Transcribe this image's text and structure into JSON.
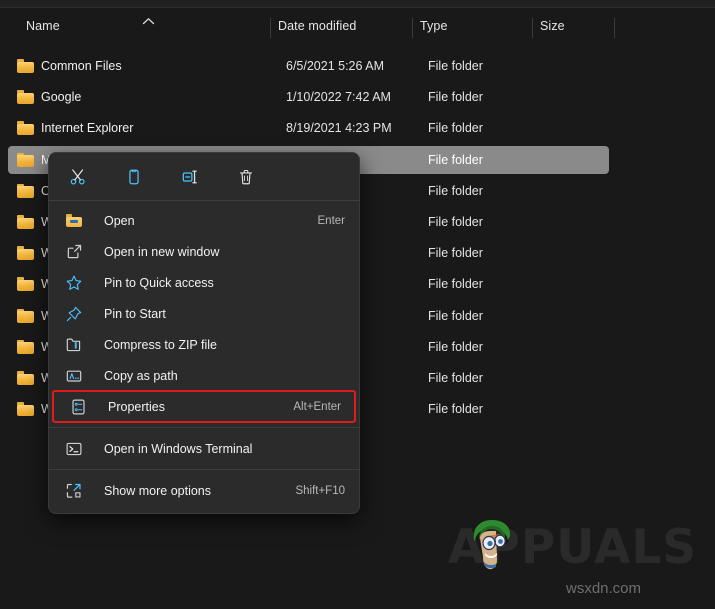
{
  "window": {
    "theme": "dark",
    "background_color": "#191919",
    "selection_color": "#8a8a8a",
    "accent_color": "#4cc2ff",
    "highlight_outline_color": "#e01b1b"
  },
  "columns": {
    "name": "Name",
    "date_modified": "Date modified",
    "type": "Type",
    "size": "Size",
    "sort_indicator": "^"
  },
  "files": [
    {
      "name": "Common Files",
      "date": "6/5/2021 5:26 AM",
      "type": "File folder",
      "size": "",
      "selected": false,
      "icon": "folder-icon"
    },
    {
      "name": "Google",
      "date": "1/10/2022 7:42 AM",
      "type": "File folder",
      "size": "",
      "selected": false,
      "icon": "folder-icon"
    },
    {
      "name": "Internet Explorer",
      "date": "8/19/2021 4:23 PM",
      "type": "File folder",
      "size": "",
      "selected": false,
      "icon": "folder-icon"
    },
    {
      "name": "M",
      "date": "",
      "type": "File folder",
      "size": "",
      "selected": true,
      "icon": "folder-icon"
    },
    {
      "name": "On",
      "date": "",
      "type": "File folder",
      "size": "",
      "selected": false,
      "icon": "folder-icon"
    },
    {
      "name": "W",
      "date": "",
      "type": "File folder",
      "size": "",
      "selected": false,
      "icon": "folder-icon"
    },
    {
      "name": "W",
      "date": "",
      "type": "File folder",
      "size": "",
      "selected": false,
      "icon": "folder-icon"
    },
    {
      "name": "W",
      "date": "",
      "type": "File folder",
      "size": "",
      "selected": false,
      "icon": "folder-icon"
    },
    {
      "name": "W",
      "date": "",
      "type": "File folder",
      "size": "",
      "selected": false,
      "icon": "folder-icon"
    },
    {
      "name": "W",
      "date": "",
      "type": "File folder",
      "size": "",
      "selected": false,
      "icon": "folder-icon"
    },
    {
      "name": "W",
      "date": "",
      "type": "File folder",
      "size": "",
      "selected": false,
      "icon": "folder-icon"
    },
    {
      "name": "W",
      "date": "",
      "type": "File folder",
      "size": "",
      "selected": false,
      "icon": "folder-icon"
    }
  ],
  "context_menu": {
    "toolbar": [
      {
        "name": "cut",
        "icon": "scissors-icon",
        "tooltip": "Cut"
      },
      {
        "name": "copy",
        "icon": "copy-icon",
        "tooltip": "Copy"
      },
      {
        "name": "rename",
        "icon": "rename-icon",
        "tooltip": "Rename"
      },
      {
        "name": "delete",
        "icon": "trash-icon",
        "tooltip": "Delete"
      }
    ],
    "items": [
      {
        "label": "Open",
        "accel": "Enter",
        "icon": "folder-open-icon",
        "highlighted": false
      },
      {
        "label": "Open in new window",
        "accel": "",
        "icon": "new-window-icon",
        "highlighted": false
      },
      {
        "label": "Pin to Quick access",
        "accel": "",
        "icon": "star-icon",
        "highlighted": false
      },
      {
        "label": "Pin to Start",
        "accel": "",
        "icon": "pin-icon",
        "highlighted": false
      },
      {
        "label": "Compress to ZIP file",
        "accel": "",
        "icon": "zip-icon",
        "highlighted": false
      },
      {
        "label": "Copy as path",
        "accel": "",
        "icon": "copy-path-icon",
        "highlighted": false
      },
      {
        "label": "Properties",
        "accel": "Alt+Enter",
        "icon": "properties-icon",
        "highlighted": true
      }
    ],
    "items_lower": [
      {
        "label": "Open in Windows Terminal",
        "accel": "",
        "icon": "terminal-icon"
      },
      {
        "label": "Show more options",
        "accel": "Shift+F10",
        "icon": "more-options-icon"
      }
    ]
  },
  "watermark": {
    "brand": "APPUALS",
    "site": "wsxdn.com"
  }
}
